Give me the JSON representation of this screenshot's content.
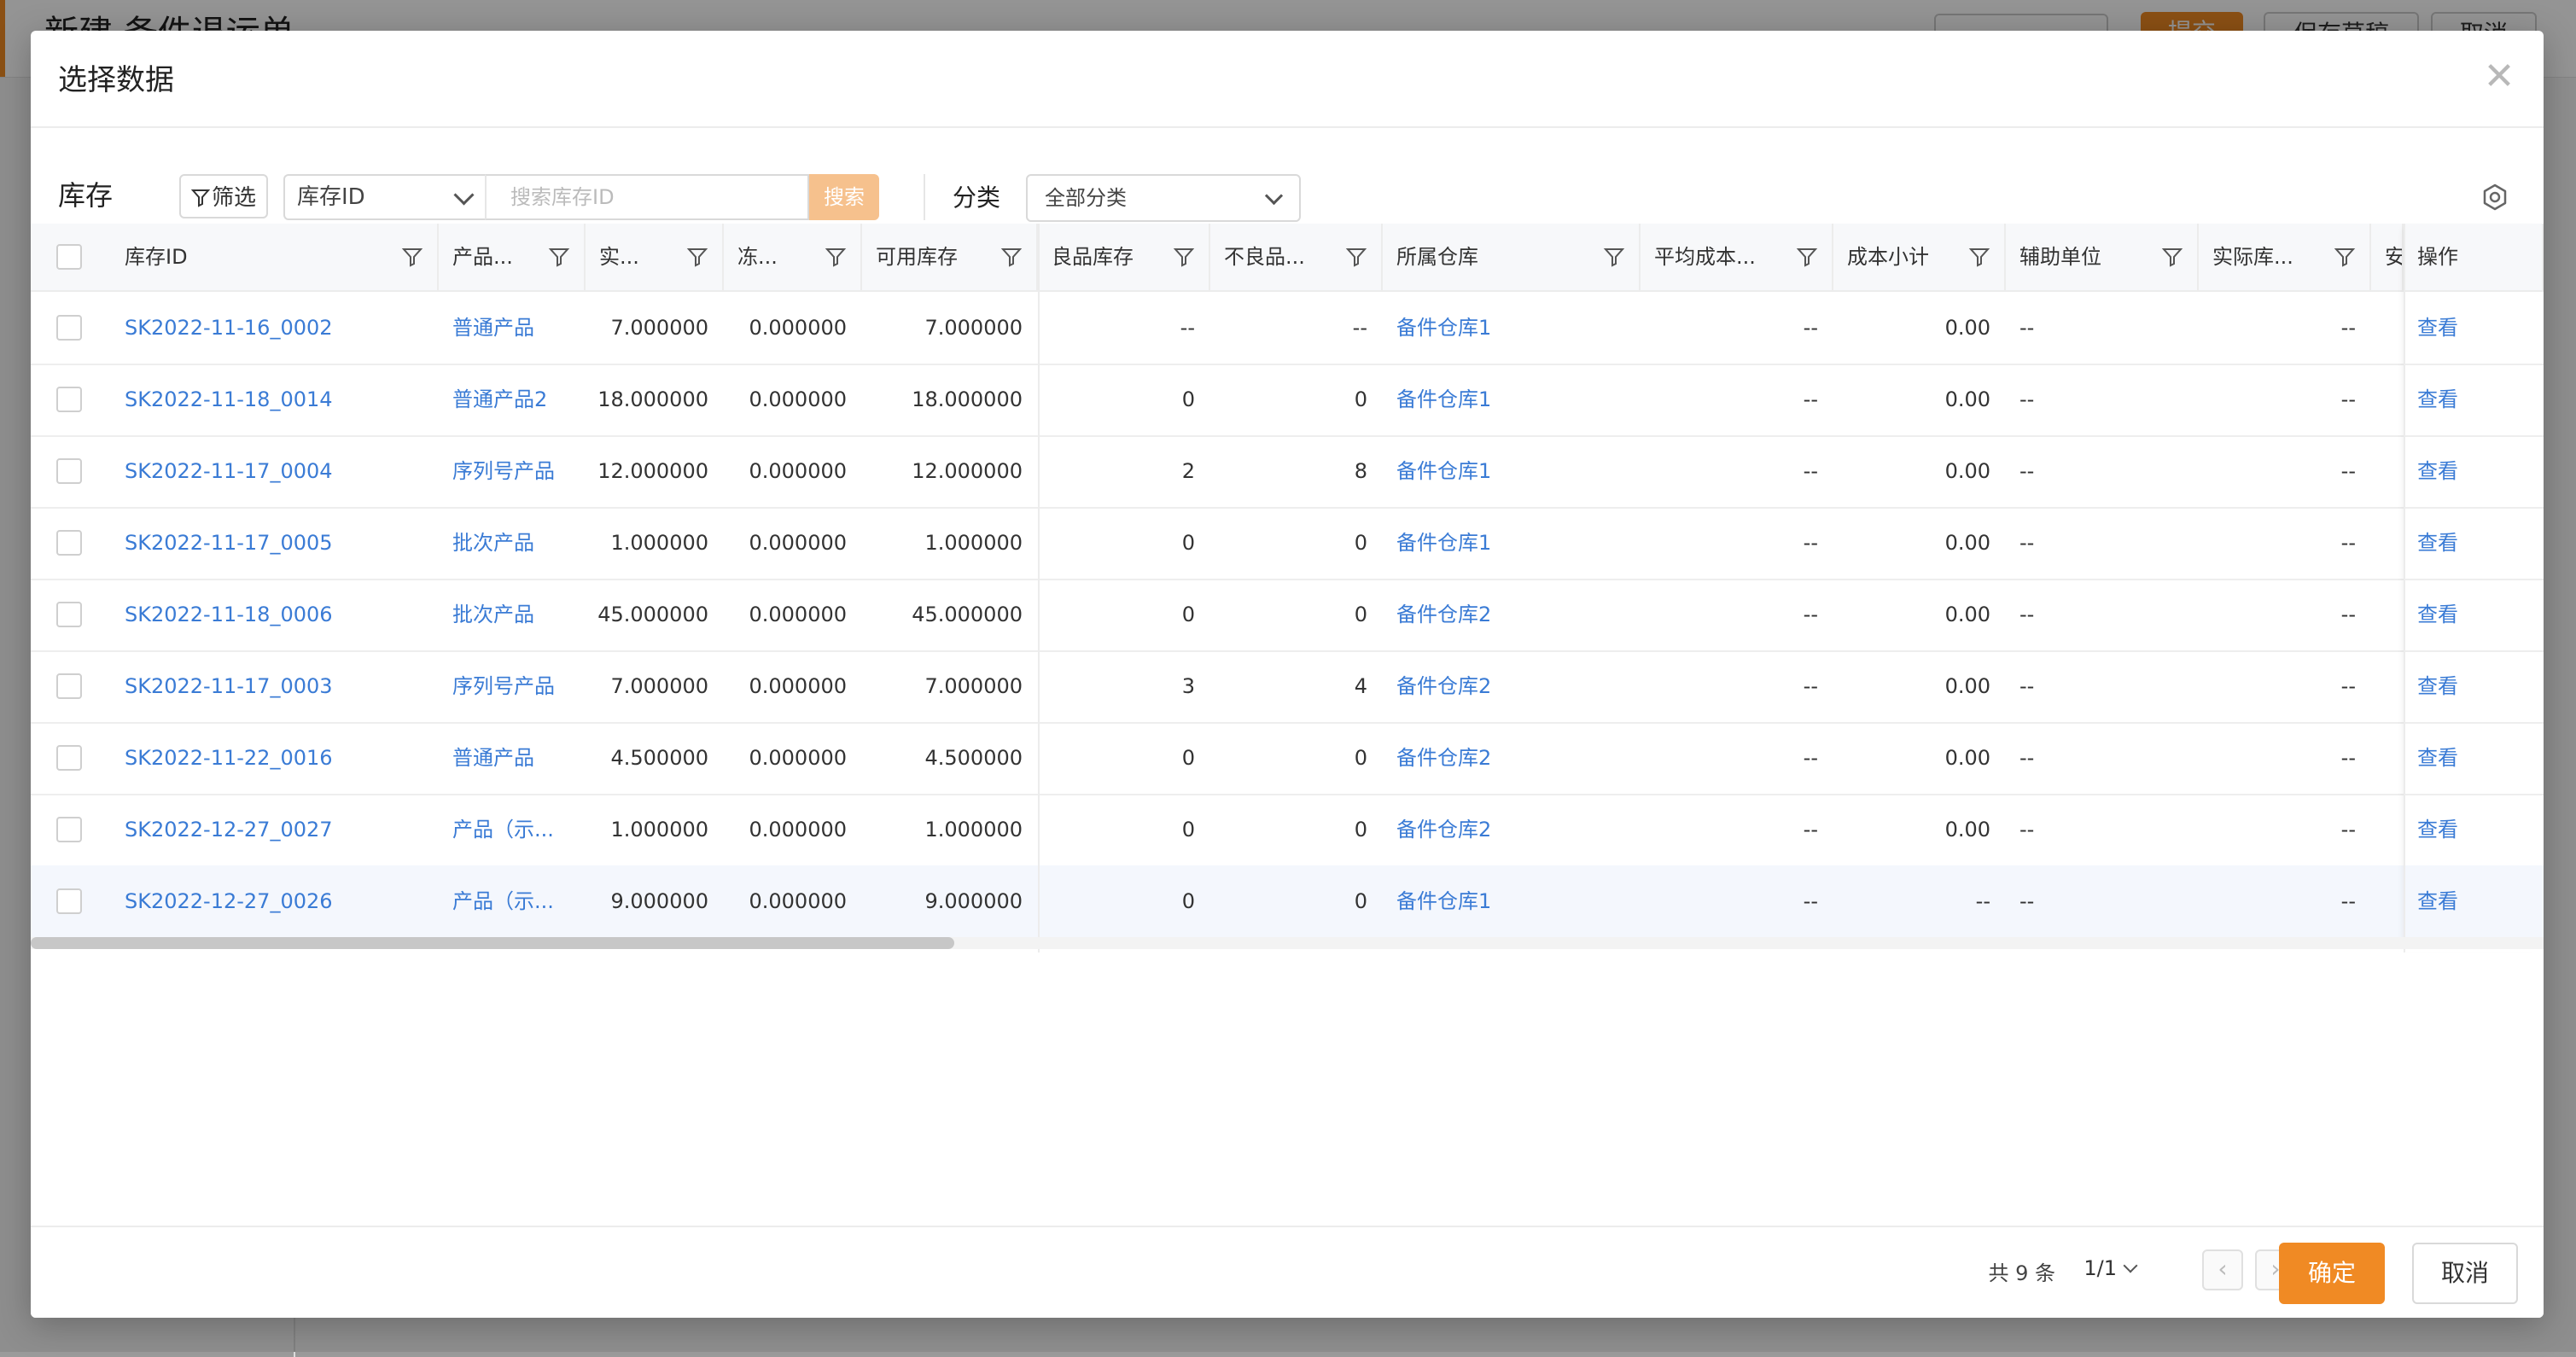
{
  "background": {
    "page_title": "新建 备件退运单",
    "submit_label": "提交",
    "save_draft_label": "保存草稿",
    "cancel_label": "取消"
  },
  "modal": {
    "title": "选择数据",
    "close_icon": "close-icon"
  },
  "toolbar": {
    "label": "库存",
    "filter_label": "筛选",
    "field_select_value": "库存ID",
    "search_placeholder": "搜索库存ID",
    "search_button": "搜索",
    "category_label": "分类",
    "category_value": "全部分类"
  },
  "table": {
    "columns": [
      {
        "key": "id",
        "label": "库存ID"
      },
      {
        "key": "product",
        "label": "产品..."
      },
      {
        "key": "actual",
        "label": "实..."
      },
      {
        "key": "frozen",
        "label": "冻..."
      },
      {
        "key": "available",
        "label": "可用库存"
      },
      {
        "key": "good",
        "label": "良品库存"
      },
      {
        "key": "bad",
        "label": "不良品..."
      },
      {
        "key": "warehouse",
        "label": "所属仓库"
      },
      {
        "key": "avg_cost",
        "label": "平均成本..."
      },
      {
        "key": "cost_subtotal",
        "label": "成本小计"
      },
      {
        "key": "aux_unit",
        "label": "辅助单位"
      },
      {
        "key": "actual_stock",
        "label": "实际库..."
      },
      {
        "key": "safe",
        "label": "安"
      },
      {
        "key": "action",
        "label": "操作"
      }
    ],
    "rows": [
      {
        "id": "SK2022-11-16_0002",
        "product": "普通产品",
        "actual": "7.000000",
        "frozen": "0.000000",
        "available": "7.000000",
        "good": "--",
        "bad": "--",
        "warehouse": "备件仓库1",
        "avg_cost": "--",
        "cost_subtotal": "0.00",
        "aux_unit": "--",
        "actual_stock": "--",
        "action": "查看"
      },
      {
        "id": "SK2022-11-18_0014",
        "product": "普通产品2",
        "actual": "18.000000",
        "frozen": "0.000000",
        "available": "18.000000",
        "good": "0",
        "bad": "0",
        "warehouse": "备件仓库1",
        "avg_cost": "--",
        "cost_subtotal": "0.00",
        "aux_unit": "--",
        "actual_stock": "--",
        "action": "查看"
      },
      {
        "id": "SK2022-11-17_0004",
        "product": "序列号产品",
        "actual": "12.000000",
        "frozen": "0.000000",
        "available": "12.000000",
        "good": "2",
        "bad": "8",
        "warehouse": "备件仓库1",
        "avg_cost": "--",
        "cost_subtotal": "0.00",
        "aux_unit": "--",
        "actual_stock": "--",
        "action": "查看"
      },
      {
        "id": "SK2022-11-17_0005",
        "product": "批次产品",
        "actual": "1.000000",
        "frozen": "0.000000",
        "available": "1.000000",
        "good": "0",
        "bad": "0",
        "warehouse": "备件仓库1",
        "avg_cost": "--",
        "cost_subtotal": "0.00",
        "aux_unit": "--",
        "actual_stock": "--",
        "action": "查看"
      },
      {
        "id": "SK2022-11-18_0006",
        "product": "批次产品",
        "actual": "45.000000",
        "frozen": "0.000000",
        "available": "45.000000",
        "good": "0",
        "bad": "0",
        "warehouse": "备件仓库2",
        "avg_cost": "--",
        "cost_subtotal": "0.00",
        "aux_unit": "--",
        "actual_stock": "--",
        "action": "查看"
      },
      {
        "id": "SK2022-11-17_0003",
        "product": "序列号产品",
        "actual": "7.000000",
        "frozen": "0.000000",
        "available": "7.000000",
        "good": "3",
        "bad": "4",
        "warehouse": "备件仓库2",
        "avg_cost": "--",
        "cost_subtotal": "0.00",
        "aux_unit": "--",
        "actual_stock": "--",
        "action": "查看"
      },
      {
        "id": "SK2022-11-22_0016",
        "product": "普通产品",
        "actual": "4.500000",
        "frozen": "0.000000",
        "available": "4.500000",
        "good": "0",
        "bad": "0",
        "warehouse": "备件仓库2",
        "avg_cost": "--",
        "cost_subtotal": "0.00",
        "aux_unit": "--",
        "actual_stock": "--",
        "action": "查看"
      },
      {
        "id": "SK2022-12-27_0027",
        "product": "产品（示...",
        "actual": "1.000000",
        "frozen": "0.000000",
        "available": "1.000000",
        "good": "0",
        "bad": "0",
        "warehouse": "备件仓库2",
        "avg_cost": "--",
        "cost_subtotal": "0.00",
        "aux_unit": "--",
        "actual_stock": "--",
        "action": "查看"
      },
      {
        "id": "SK2022-12-27_0026",
        "product": "产品（示...",
        "actual": "9.000000",
        "frozen": "0.000000",
        "available": "9.000000",
        "good": "0",
        "bad": "0",
        "warehouse": "备件仓库1",
        "avg_cost": "--",
        "cost_subtotal": "--",
        "aux_unit": "--",
        "actual_stock": "--",
        "action": "查看"
      }
    ]
  },
  "footer": {
    "total_label": "共 9 条",
    "page_label": "1/1",
    "prev_icon": "chevron-left-icon",
    "next_icon": "chevron-right-icon",
    "confirm_label": "确定",
    "cancel_label": "取消"
  },
  "colors": {
    "accent": "#f08a24",
    "link": "#3a7bd5"
  }
}
